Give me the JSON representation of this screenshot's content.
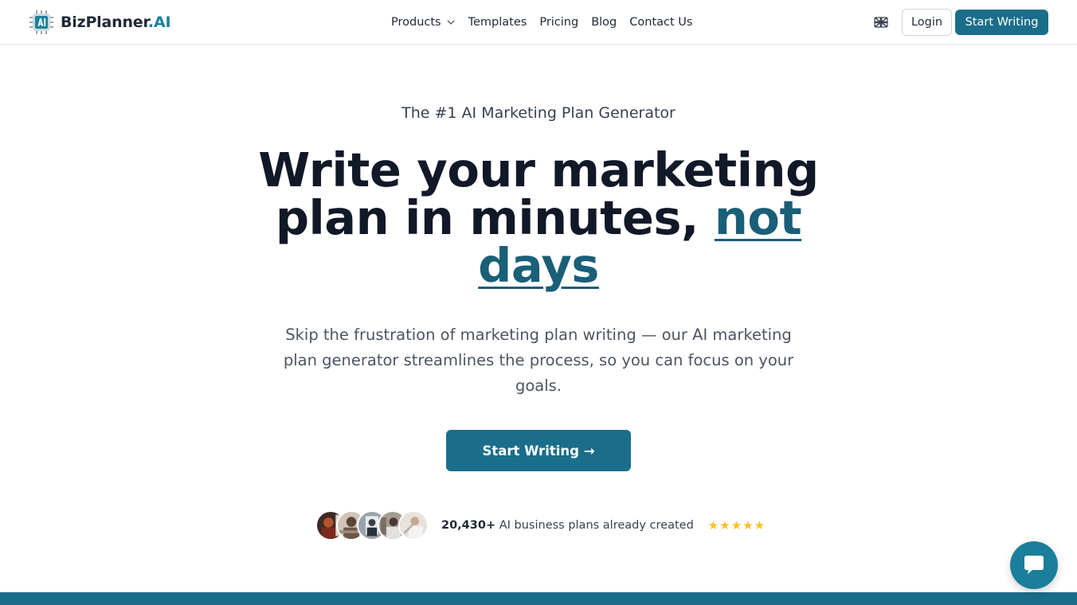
{
  "brand": {
    "name_main": "BizPlanner",
    "name_accent": ".AI",
    "logo_icon": "chip-ai-icon"
  },
  "nav": {
    "items": [
      {
        "label": "Products",
        "has_dropdown": true
      },
      {
        "label": "Templates"
      },
      {
        "label": "Pricing"
      },
      {
        "label": "Blog"
      },
      {
        "label": "Contact Us"
      }
    ],
    "language_icon": "uk-flag-icon",
    "login_label": "Login",
    "start_label": "Start Writing"
  },
  "hero": {
    "eyebrow": "The #1 AI Marketing Plan Generator",
    "headline_part1": "Write your marketing plan in minutes, ",
    "headline_highlight": "not days",
    "subtext": "Skip the frustration of marketing plan writing — our AI marketing plan generator streamlines the process, so you can focus on your goals.",
    "cta_label": "Start Writing →"
  },
  "social_proof": {
    "count": "20,430+",
    "text": " AI business plans already created",
    "rating_stars": 5
  },
  "colors": {
    "primary": "#1a6e8a",
    "accent": "#1a7f9b",
    "highlight": "#1a5f78",
    "star": "#fbbf24"
  },
  "chat": {
    "icon": "chat-bubble-icon"
  }
}
